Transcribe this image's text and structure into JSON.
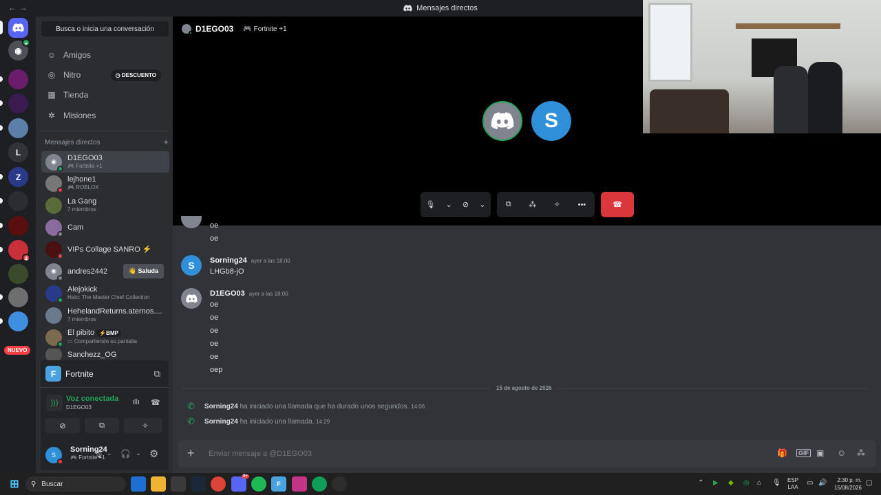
{
  "window": {
    "title": "Mensajes directos"
  },
  "guilds": {
    "letter_server": "L",
    "new_label": "NUEVO",
    "badge_count": "4"
  },
  "sidebar": {
    "search_label": "Busca o inicia una conversación",
    "nav": [
      {
        "label": "Amigos"
      },
      {
        "label": "Nitro",
        "badge": "DESCUENTO"
      },
      {
        "label": "Tienda"
      },
      {
        "label": "Misiones"
      }
    ],
    "dm_header": "Mensajes directos",
    "dms": [
      {
        "name": "D1EGO03",
        "sub": "Fortnite +1"
      },
      {
        "name": "lejhone1",
        "sub": "ROBLOX"
      },
      {
        "name": "La Gang",
        "sub": "7 miembros"
      },
      {
        "name": "Cam",
        "sub": ""
      },
      {
        "name": "VIPs Collage SANRO",
        "sub": ""
      },
      {
        "name": "andres2442",
        "sub": "",
        "action": "Saluda"
      },
      {
        "name": "Alejokick",
        "sub": "Halo: The Master Chief Collection"
      },
      {
        "name": "HehelandReturns.aternos....",
        "sub": "7 miembros"
      },
      {
        "name": "El pibito",
        "tag": "BMP",
        "sub": "Compartiendo su pantalla"
      },
      {
        "name": "Sanchezz_OG",
        "sub": ""
      }
    ]
  },
  "activity": {
    "game": "Fortnite"
  },
  "voice": {
    "status": "Voz conectada",
    "channel": "D1EGO03"
  },
  "user": {
    "name": "Sorning24",
    "status": "Fortnite +1"
  },
  "call": {
    "peer_name": "D1EGO03",
    "peer_activity": "Fortnite +1"
  },
  "messages": {
    "prev_lines": [
      "oe",
      "oe"
    ],
    "groups": [
      {
        "author": "Sorning24",
        "time": "ayer a las 18:00",
        "lines": [
          "LHGb8-jO"
        ]
      },
      {
        "author": "D1EGO03",
        "time": "ayer a las 18:00",
        "lines": [
          "oe",
          "oe",
          "oe",
          "oe",
          "oe",
          "oep"
        ]
      }
    ],
    "date_divider": "15 de agosto de 2026",
    "system": [
      {
        "author": "Sorning24",
        "text": "ha iniciado una llamada que ha durado unos segundos.",
        "time": "14:06"
      },
      {
        "author": "Sorning24",
        "text": "ha iniciado una llamada.",
        "time": "14:29"
      }
    ]
  },
  "composer": {
    "placeholder": "Enviar mensaje a @D1EGO03"
  },
  "taskbar": {
    "search": "Buscar",
    "lang1": "ESP",
    "lang2": "LAA",
    "time": "2:30 p. m.",
    "date": "15/08/2026",
    "discord_badge": "9+"
  },
  "colors": {
    "blurple": "#5865f2",
    "green": "#23a559",
    "red": "#da373c"
  }
}
